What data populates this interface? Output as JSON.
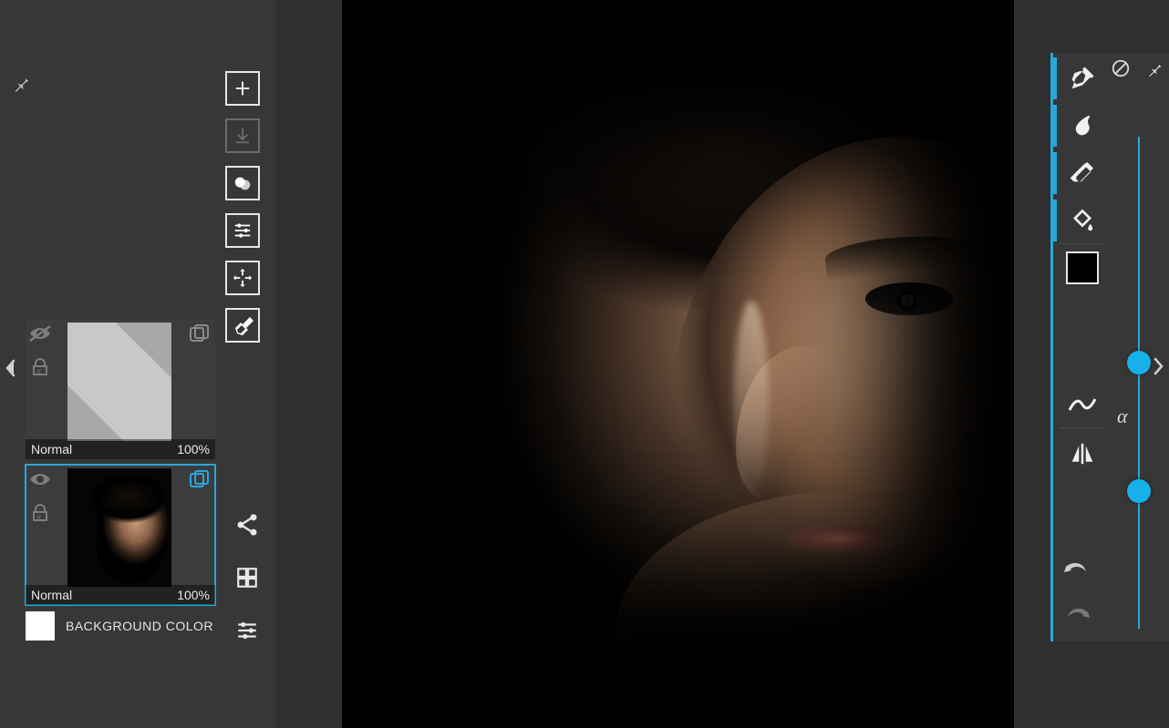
{
  "layer_toolbar": {
    "add": "add-layer",
    "merge_down": "merge-down",
    "blend": "blend-shapes",
    "adjust": "adjust-sliders",
    "transform": "transform",
    "clear": "clear-brush"
  },
  "layers": [
    {
      "blend_mode": "Normal",
      "opacity": "100%",
      "visible": false,
      "selected": false,
      "thumb": "transparent"
    },
    {
      "blend_mode": "Normal",
      "opacity": "100%",
      "visible": true,
      "selected": true,
      "thumb": "portrait"
    }
  ],
  "background": {
    "label": "BACKGROUND COLOR",
    "color": "#ffffff"
  },
  "bottom_actions": {
    "share": "share",
    "grid": "grid-view",
    "sliders": "settings-sliders"
  },
  "right_panel": {
    "disable": "disable",
    "pin": "pin",
    "tools": {
      "pen": "pen-tool",
      "smudge": "smudge-tool",
      "eraser": "eraser-tool",
      "bucket": "bucket-tool"
    },
    "color_chip": "#000000",
    "curve": "stroke-curve",
    "mirror": "mirror",
    "alpha": "α",
    "undo": "undo",
    "redo": "redo",
    "slider1_pos": 0.46,
    "slider2_pos": 0.72
  }
}
